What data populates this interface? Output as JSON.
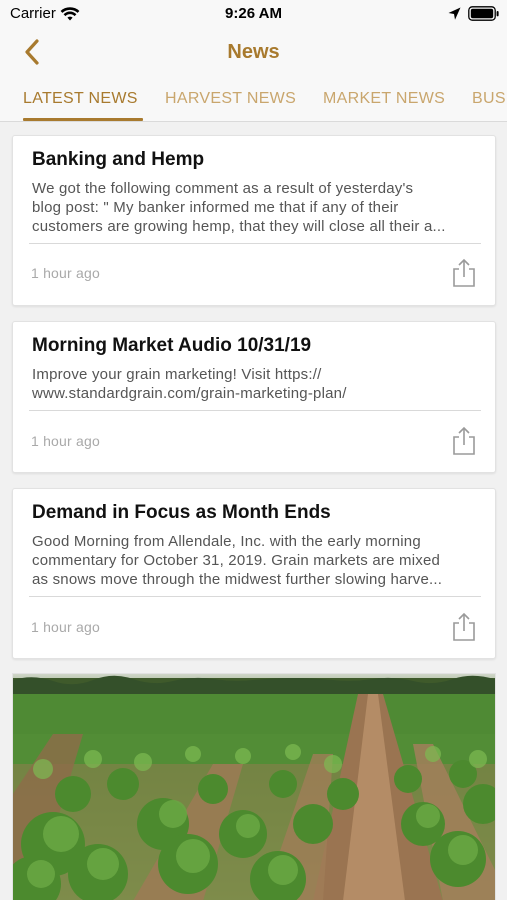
{
  "status_bar": {
    "carrier": "Carrier",
    "time": "9:26 AM",
    "icons": [
      "wifi-icon",
      "location-arrow-icon",
      "battery-icon"
    ]
  },
  "navbar": {
    "title": "News",
    "back_icon": "chevron-left-icon"
  },
  "tabs": [
    {
      "label": "LATEST NEWS",
      "active": true
    },
    {
      "label": "HARVEST NEWS",
      "active": false
    },
    {
      "label": "MARKET NEWS",
      "active": false
    },
    {
      "label": "BUS",
      "active": false
    }
  ],
  "articles": [
    {
      "title": "Banking and Hemp",
      "body_lines": [
        "We got the following comment as a result of yesterday's",
        "blog post: \" My banker informed me that if any of their",
        "customers are growing hemp, that they will close all their a..."
      ],
      "time": "1 hour ago"
    },
    {
      "title": "Morning Market Audio 10/31/19",
      "body_lines": [
        "Improve your grain marketing! Visit https://",
        "www.standardgrain.com/grain-marketing-plan/"
      ],
      "time": "1 hour ago"
    },
    {
      "title": "Demand in Focus as Month Ends",
      "body_lines": [
        "Good Morning from Allendale, Inc. with the early morning",
        "commentary for October 31, 2019. Grain markets are mixed",
        "as snows move through the midwest further slowing harve..."
      ],
      "time": "1 hour ago"
    }
  ],
  "colors": {
    "accent": "#a87a2e",
    "tab_inactive": "#c9a66d",
    "background": "#f1f1f1"
  }
}
